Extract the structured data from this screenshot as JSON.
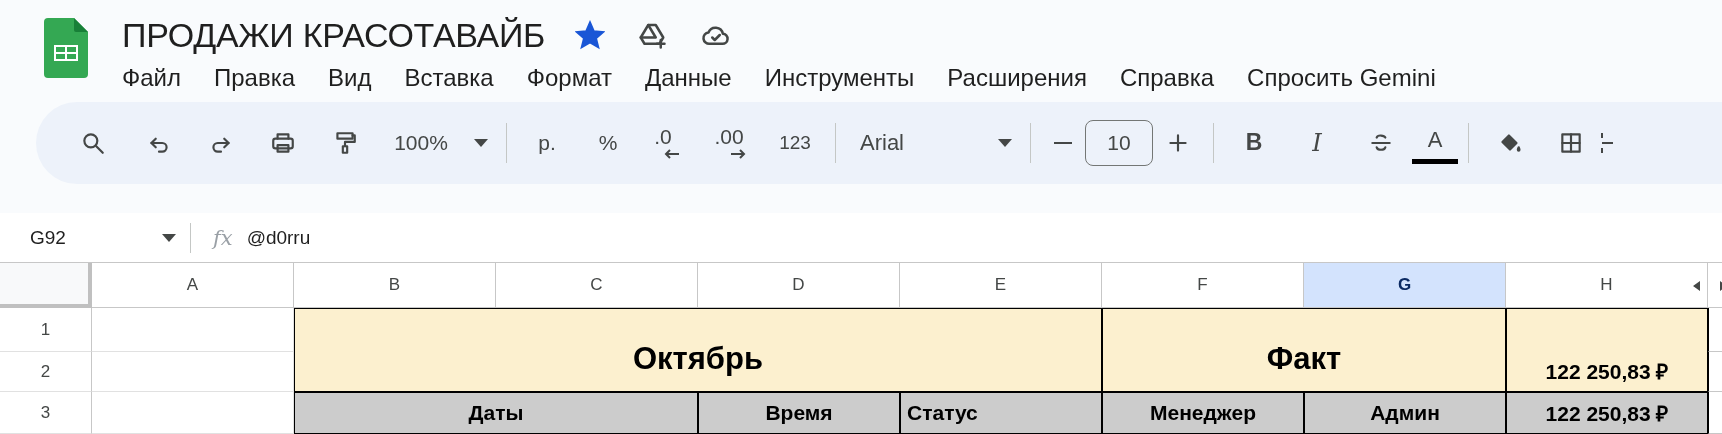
{
  "document": {
    "title": "ПРОДАЖИ КРАСОТАВАЙБ",
    "starred": true
  },
  "menu": [
    "Файл",
    "Правка",
    "Вид",
    "Вставка",
    "Формат",
    "Данные",
    "Инструменты",
    "Расширения",
    "Справка",
    "Спросить Gemini"
  ],
  "toolbar": {
    "zoom": "100%",
    "currency": "р.",
    "percent": "%",
    "decrease_decimals": ".0",
    "increase_decimals": ".00",
    "number_format": "123",
    "font": "Arial",
    "font_size": "10",
    "bold": "B",
    "italic": "I",
    "text_color": "A"
  },
  "formula_bar": {
    "cell_ref": "G92",
    "fx": "fx",
    "value": "@d0rru"
  },
  "columns": [
    {
      "label": "A",
      "selected": false
    },
    {
      "label": "B",
      "selected": false
    },
    {
      "label": "C",
      "selected": false
    },
    {
      "label": "D",
      "selected": false
    },
    {
      "label": "E",
      "selected": false
    },
    {
      "label": "F",
      "selected": false
    },
    {
      "label": "G",
      "selected": true
    },
    {
      "label": "H",
      "selected": false
    }
  ],
  "rows": [
    {
      "number": "1",
      "cells": [
        {
          "kind": "empty"
        },
        {
          "kind": "title",
          "text": "Октябрь",
          "colspan": 4,
          "rowspan": 2
        },
        {
          "kind": "title",
          "text": "Факт",
          "colspan": 2,
          "rowspan": 2
        },
        {
          "kind": "total",
          "text": "122 250,83 ₽",
          "rowspan": 2
        }
      ]
    },
    {
      "number": "2",
      "cells": [
        {
          "kind": "empty"
        }
      ]
    },
    {
      "number": "3",
      "cells": [
        {
          "kind": "empty"
        },
        {
          "kind": "header",
          "text": "Даты",
          "colspan": 2
        },
        {
          "kind": "header",
          "text": "Время"
        },
        {
          "kind": "header",
          "text": "Статус",
          "left_aligned": true
        },
        {
          "kind": "header",
          "text": "Менеджер"
        },
        {
          "kind": "header",
          "text": "Админ"
        },
        {
          "kind": "header",
          "text": "122 250,83 ₽"
        }
      ]
    }
  ]
}
